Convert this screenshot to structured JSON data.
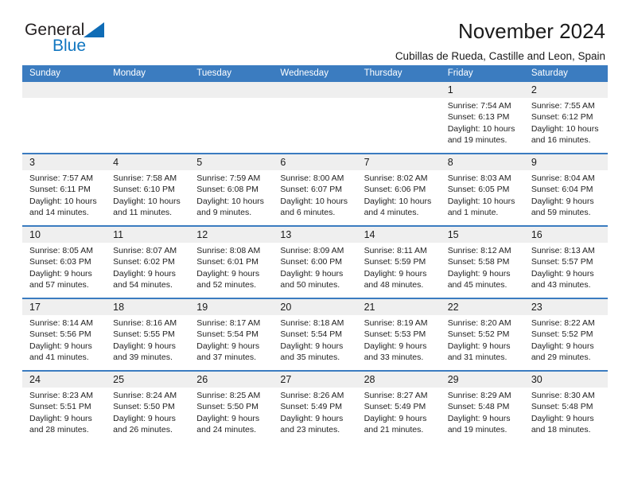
{
  "brand": {
    "name_part1": "General",
    "name_part2": "Blue"
  },
  "header": {
    "title": "November 2024",
    "subtitle": "Cubillas de Rueda, Castille and Leon, Spain"
  },
  "calendar": {
    "weekday_headers": [
      "Sunday",
      "Monday",
      "Tuesday",
      "Wednesday",
      "Thursday",
      "Friday",
      "Saturday"
    ],
    "accent_color": "#3b7cc0",
    "day_header_bg": "#efefef",
    "weeks": [
      [
        {
          "day": "",
          "lines": []
        },
        {
          "day": "",
          "lines": []
        },
        {
          "day": "",
          "lines": []
        },
        {
          "day": "",
          "lines": []
        },
        {
          "day": "",
          "lines": []
        },
        {
          "day": "1",
          "lines": [
            "Sunrise: 7:54 AM",
            "Sunset: 6:13 PM",
            "Daylight: 10 hours",
            "and 19 minutes."
          ]
        },
        {
          "day": "2",
          "lines": [
            "Sunrise: 7:55 AM",
            "Sunset: 6:12 PM",
            "Daylight: 10 hours",
            "and 16 minutes."
          ]
        }
      ],
      [
        {
          "day": "3",
          "lines": [
            "Sunrise: 7:57 AM",
            "Sunset: 6:11 PM",
            "Daylight: 10 hours",
            "and 14 minutes."
          ]
        },
        {
          "day": "4",
          "lines": [
            "Sunrise: 7:58 AM",
            "Sunset: 6:10 PM",
            "Daylight: 10 hours",
            "and 11 minutes."
          ]
        },
        {
          "day": "5",
          "lines": [
            "Sunrise: 7:59 AM",
            "Sunset: 6:08 PM",
            "Daylight: 10 hours",
            "and 9 minutes."
          ]
        },
        {
          "day": "6",
          "lines": [
            "Sunrise: 8:00 AM",
            "Sunset: 6:07 PM",
            "Daylight: 10 hours",
            "and 6 minutes."
          ]
        },
        {
          "day": "7",
          "lines": [
            "Sunrise: 8:02 AM",
            "Sunset: 6:06 PM",
            "Daylight: 10 hours",
            "and 4 minutes."
          ]
        },
        {
          "day": "8",
          "lines": [
            "Sunrise: 8:03 AM",
            "Sunset: 6:05 PM",
            "Daylight: 10 hours",
            "and 1 minute."
          ]
        },
        {
          "day": "9",
          "lines": [
            "Sunrise: 8:04 AM",
            "Sunset: 6:04 PM",
            "Daylight: 9 hours",
            "and 59 minutes."
          ]
        }
      ],
      [
        {
          "day": "10",
          "lines": [
            "Sunrise: 8:05 AM",
            "Sunset: 6:03 PM",
            "Daylight: 9 hours",
            "and 57 minutes."
          ]
        },
        {
          "day": "11",
          "lines": [
            "Sunrise: 8:07 AM",
            "Sunset: 6:02 PM",
            "Daylight: 9 hours",
            "and 54 minutes."
          ]
        },
        {
          "day": "12",
          "lines": [
            "Sunrise: 8:08 AM",
            "Sunset: 6:01 PM",
            "Daylight: 9 hours",
            "and 52 minutes."
          ]
        },
        {
          "day": "13",
          "lines": [
            "Sunrise: 8:09 AM",
            "Sunset: 6:00 PM",
            "Daylight: 9 hours",
            "and 50 minutes."
          ]
        },
        {
          "day": "14",
          "lines": [
            "Sunrise: 8:11 AM",
            "Sunset: 5:59 PM",
            "Daylight: 9 hours",
            "and 48 minutes."
          ]
        },
        {
          "day": "15",
          "lines": [
            "Sunrise: 8:12 AM",
            "Sunset: 5:58 PM",
            "Daylight: 9 hours",
            "and 45 minutes."
          ]
        },
        {
          "day": "16",
          "lines": [
            "Sunrise: 8:13 AM",
            "Sunset: 5:57 PM",
            "Daylight: 9 hours",
            "and 43 minutes."
          ]
        }
      ],
      [
        {
          "day": "17",
          "lines": [
            "Sunrise: 8:14 AM",
            "Sunset: 5:56 PM",
            "Daylight: 9 hours",
            "and 41 minutes."
          ]
        },
        {
          "day": "18",
          "lines": [
            "Sunrise: 8:16 AM",
            "Sunset: 5:55 PM",
            "Daylight: 9 hours",
            "and 39 minutes."
          ]
        },
        {
          "day": "19",
          "lines": [
            "Sunrise: 8:17 AM",
            "Sunset: 5:54 PM",
            "Daylight: 9 hours",
            "and 37 minutes."
          ]
        },
        {
          "day": "20",
          "lines": [
            "Sunrise: 8:18 AM",
            "Sunset: 5:54 PM",
            "Daylight: 9 hours",
            "and 35 minutes."
          ]
        },
        {
          "day": "21",
          "lines": [
            "Sunrise: 8:19 AM",
            "Sunset: 5:53 PM",
            "Daylight: 9 hours",
            "and 33 minutes."
          ]
        },
        {
          "day": "22",
          "lines": [
            "Sunrise: 8:20 AM",
            "Sunset: 5:52 PM",
            "Daylight: 9 hours",
            "and 31 minutes."
          ]
        },
        {
          "day": "23",
          "lines": [
            "Sunrise: 8:22 AM",
            "Sunset: 5:52 PM",
            "Daylight: 9 hours",
            "and 29 minutes."
          ]
        }
      ],
      [
        {
          "day": "24",
          "lines": [
            "Sunrise: 8:23 AM",
            "Sunset: 5:51 PM",
            "Daylight: 9 hours",
            "and 28 minutes."
          ]
        },
        {
          "day": "25",
          "lines": [
            "Sunrise: 8:24 AM",
            "Sunset: 5:50 PM",
            "Daylight: 9 hours",
            "and 26 minutes."
          ]
        },
        {
          "day": "26",
          "lines": [
            "Sunrise: 8:25 AM",
            "Sunset: 5:50 PM",
            "Daylight: 9 hours",
            "and 24 minutes."
          ]
        },
        {
          "day": "27",
          "lines": [
            "Sunrise: 8:26 AM",
            "Sunset: 5:49 PM",
            "Daylight: 9 hours",
            "and 23 minutes."
          ]
        },
        {
          "day": "28",
          "lines": [
            "Sunrise: 8:27 AM",
            "Sunset: 5:49 PM",
            "Daylight: 9 hours",
            "and 21 minutes."
          ]
        },
        {
          "day": "29",
          "lines": [
            "Sunrise: 8:29 AM",
            "Sunset: 5:48 PM",
            "Daylight: 9 hours",
            "and 19 minutes."
          ]
        },
        {
          "day": "30",
          "lines": [
            "Sunrise: 8:30 AM",
            "Sunset: 5:48 PM",
            "Daylight: 9 hours",
            "and 18 minutes."
          ]
        }
      ]
    ]
  }
}
